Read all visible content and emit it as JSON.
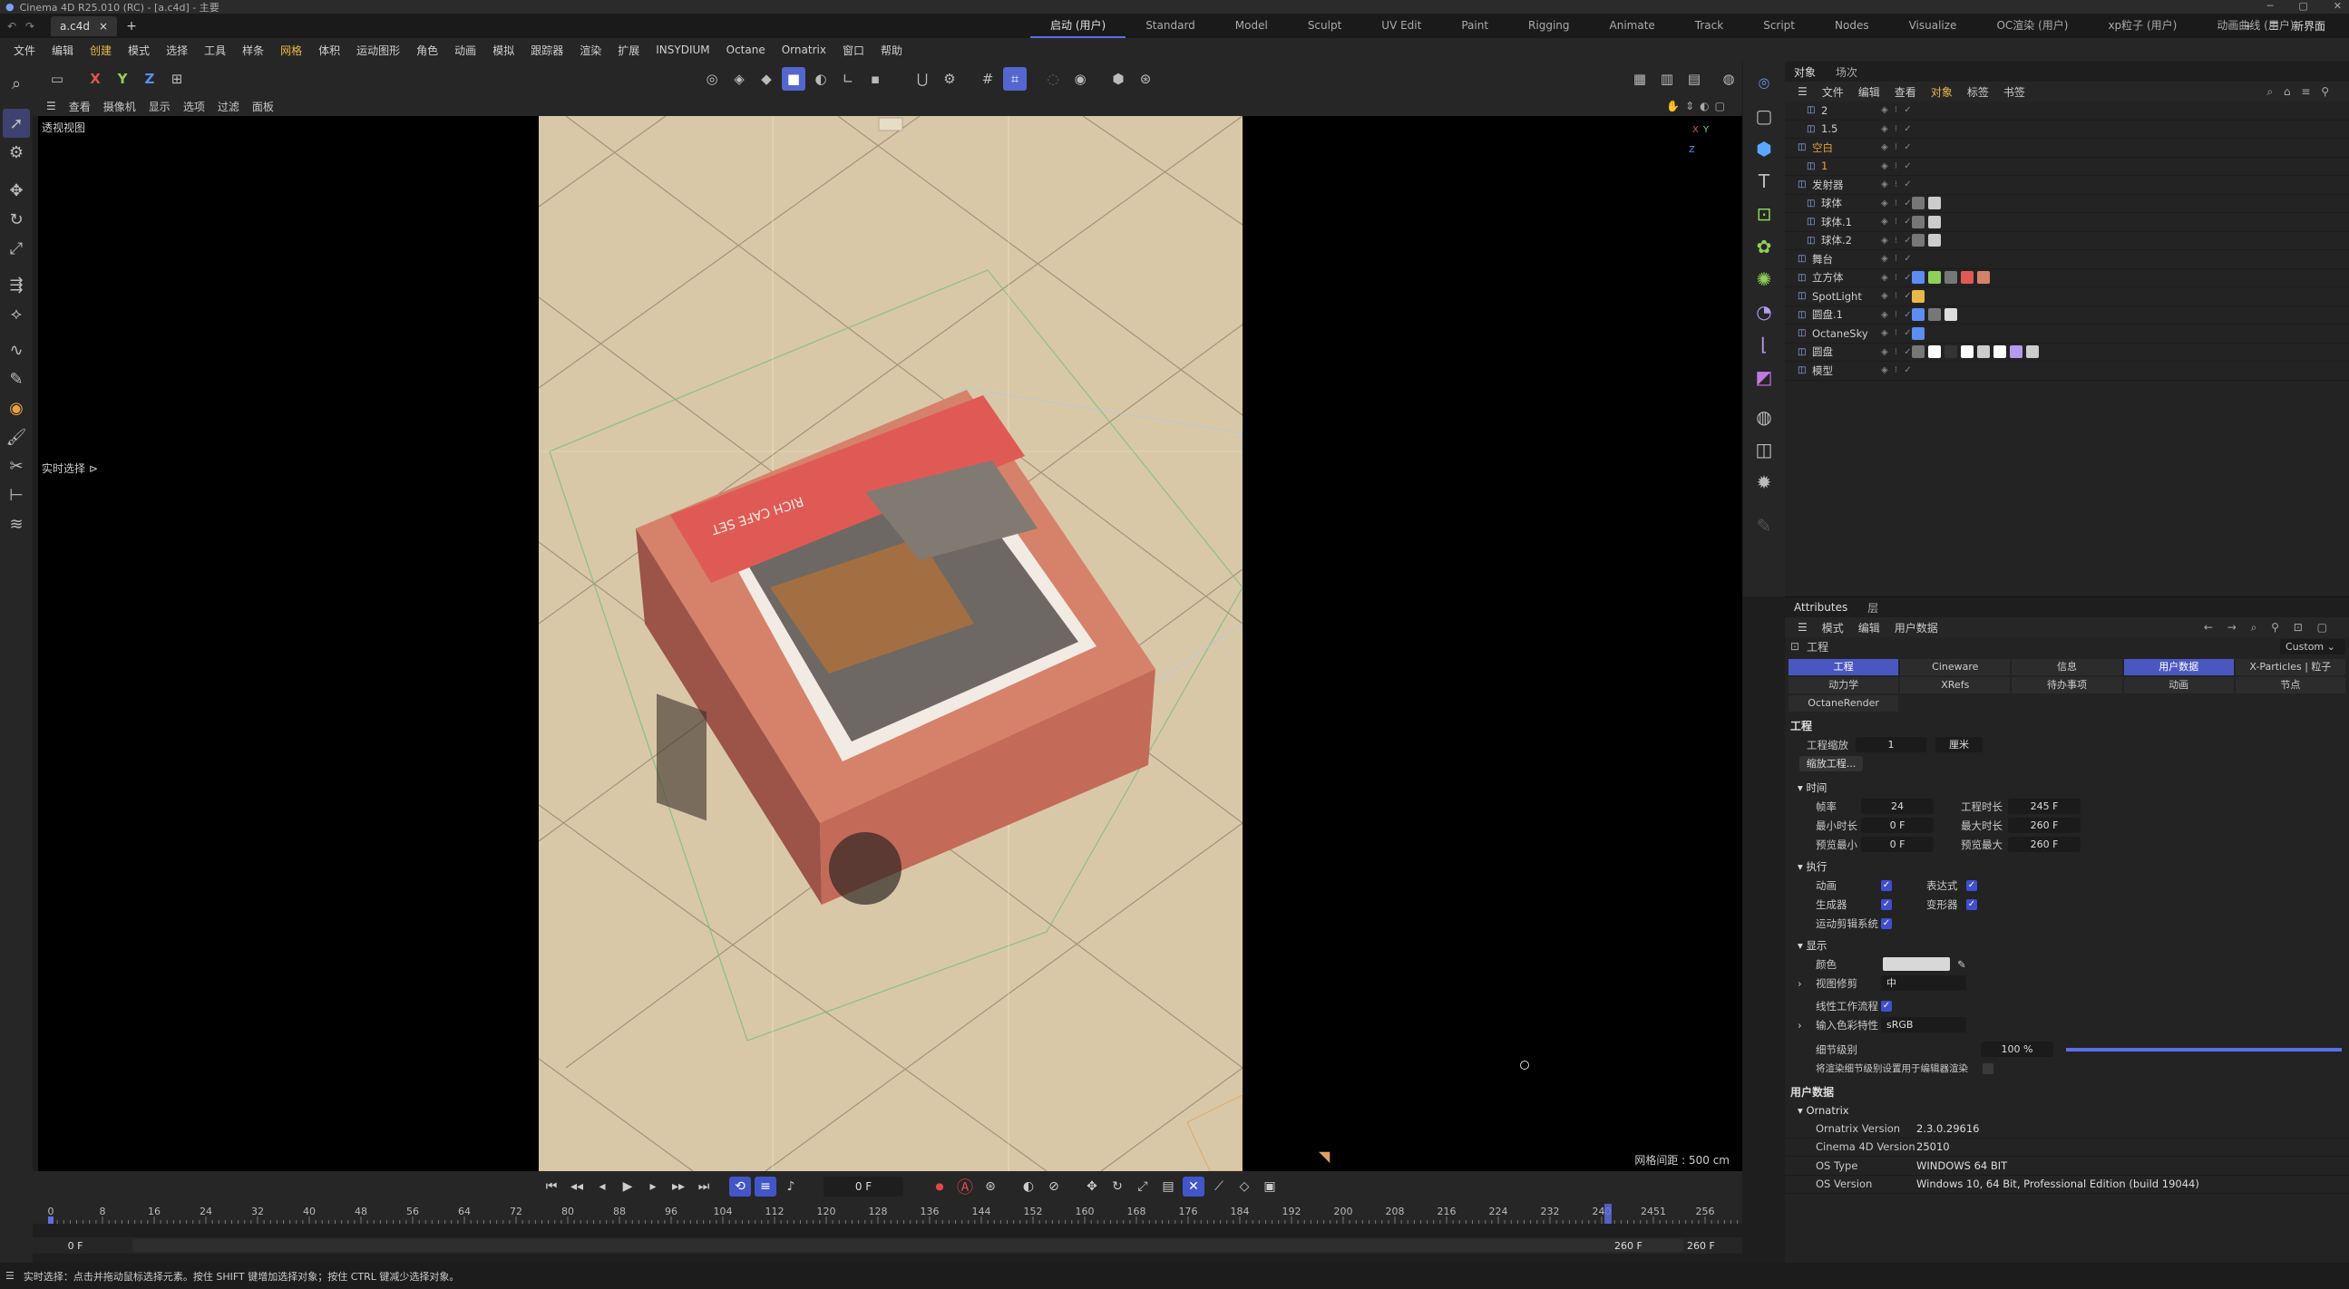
{
  "window": {
    "title": "Cinema 4D R25.010 (RC) - [a.c4d] - 主要"
  },
  "tabs": {
    "doc_tab": "a.c4d",
    "close_glyph": "×",
    "add_glyph": "+"
  },
  "layouts": [
    "启动 (用户)",
    "Standard",
    "Model",
    "Sculpt",
    "UV Edit",
    "Paint",
    "Rigging",
    "Animate",
    "Track",
    "Script",
    "Nodes",
    "Visualize",
    "OC渲染 (用户)",
    "xp粒子 (用户)",
    "动画曲线 (用户)"
  ],
  "layout_right": "新界面",
  "menu": [
    "文件",
    "编辑",
    "创建",
    "模式",
    "选择",
    "工具",
    "样条",
    "网格",
    "体积",
    "运动图形",
    "角色",
    "动画",
    "模拟",
    "跟踪器",
    "渲染",
    "扩展",
    "INSYDIUM",
    "Octane",
    "Ornatrix",
    "窗口",
    "帮助"
  ],
  "menu_highlight": [
    "创建",
    "网格"
  ],
  "toolbar": {
    "axis_x": "X",
    "axis_y": "Y",
    "axis_z": "Z"
  },
  "viewport_menu": [
    "查看",
    "摄像机",
    "显示",
    "选项",
    "过滤",
    "面板"
  ],
  "viewport": {
    "label": "透视视图",
    "realtime": "实时选择",
    "grid_spacing": "网格间距 : 500 cm",
    "box_text": "RICH CAFE SET"
  },
  "timeline": {
    "current_frame": "0 F",
    "ruler_labels": [
      "0",
      "8",
      "16",
      "24",
      "32",
      "40",
      "48",
      "56",
      "64",
      "72",
      "80",
      "88",
      "96",
      "104",
      "112",
      "120",
      "128",
      "136",
      "144",
      "152",
      "160",
      "168",
      "176",
      "184",
      "192",
      "200",
      "208",
      "216",
      "224",
      "232",
      "240",
      "2451",
      "256"
    ],
    "range_start": "0 F",
    "range_current": "0 F",
    "range_end": "260 F",
    "range_end2": "260 F"
  },
  "status": "实时选择：点击并拖动鼠标选择元素。按住 SHIFT 键增加选择对象；按住 CTRL 键减少选择对象。",
  "object_panel": {
    "tabs": [
      "对象",
      "场次"
    ],
    "menu": [
      "文件",
      "编辑",
      "查看",
      "对象",
      "标签",
      "书签"
    ],
    "menu_highlight": "对象",
    "objects": [
      {
        "name": "2",
        "indent": 1,
        "orange": false
      },
      {
        "name": "1.5",
        "indent": 1,
        "orange": false
      },
      {
        "name": "空白",
        "indent": 0,
        "orange": true
      },
      {
        "name": "1",
        "indent": 1,
        "orange": true
      },
      {
        "name": "发射器",
        "indent": 0,
        "orange": false
      },
      {
        "name": "球体",
        "indent": 1,
        "orange": false
      },
      {
        "name": "球体.1",
        "indent": 1,
        "orange": false
      },
      {
        "name": "球体.2",
        "indent": 1,
        "orange": false
      },
      {
        "name": "舞台",
        "indent": 0,
        "orange": false
      },
      {
        "name": "立方体",
        "indent": 0,
        "orange": false
      },
      {
        "name": "SpotLight",
        "indent": 0,
        "orange": false
      },
      {
        "name": "圆盘.1",
        "indent": 0,
        "orange": false
      },
      {
        "name": "OctaneSky",
        "indent": 0,
        "orange": false
      },
      {
        "name": "圆盘",
        "indent": 0,
        "orange": false
      },
      {
        "name": "模型",
        "indent": 0,
        "orange": false
      }
    ]
  },
  "attributes": {
    "tabs": [
      "Attributes",
      "层"
    ],
    "menu": [
      "模式",
      "编辑",
      "用户数据"
    ],
    "mode_label": "工程",
    "preset": "Custom",
    "tab_row1": [
      "工程",
      "Cineware",
      "信息",
      "用户数据",
      "X-Particles | 粒子"
    ],
    "tab_row2": [
      "动力学",
      "XRefs",
      "待办事项",
      "动画",
      "节点"
    ],
    "tab_row3": [
      "OctaneRender"
    ],
    "active_tabs": [
      "工程",
      "用户数据"
    ],
    "section_project": "工程",
    "scale_label": "工程缩放",
    "scale_value": "1",
    "scale_unit": "厘米",
    "scale_button": "缩放工程...",
    "time_title": "时间",
    "fps_label": "帧率",
    "fps": "24",
    "proj_len_label": "工程时长",
    "proj_len": "245 F",
    "min_time_label": "最小时长",
    "min_time": "0 F",
    "max_time_label": "最大时长",
    "max_time": "260 F",
    "prev_min_label": "预览最小",
    "prev_min": "0 F",
    "prev_max_label": "预览最大",
    "prev_max": "260 F",
    "exec_title": "执行",
    "anim_label": "动画",
    "expr_label": "表达式",
    "gen_label": "生成器",
    "deform_label": "变形器",
    "motion_label": "运动剪辑系统",
    "display_title": "显示",
    "color_label": "颜色",
    "clip_label": "视图修剪",
    "clip_value": "中",
    "linear_label": "线性工作流程",
    "input_color_label": "输入色彩特性",
    "input_color_value": "sRGB",
    "lod_label": "细节级别",
    "lod_value": "100 %",
    "lod_fraction": 1.0,
    "lod_editor_label": "将渲染细节级别设置用于编辑器渲染",
    "userdata_title": "用户数据",
    "ornatrix_title": "Ornatrix",
    "info": [
      {
        "k": "Ornatrix Version",
        "v": "2.3.0.29616"
      },
      {
        "k": "Cinema 4D Version",
        "v": "25010"
      },
      {
        "k": "OS Type",
        "v": "WINDOWS 64 BIT"
      },
      {
        "k": "OS Version",
        "v": "Windows 10, 64 Bit, Professional Edition (build 19044)"
      }
    ]
  },
  "colors": {
    "accent": "#5466d0",
    "highlight": "#e8b84a",
    "floor": "#d9c8a8",
    "box_side": "#d6826a",
    "box_band": "#e05a55"
  }
}
